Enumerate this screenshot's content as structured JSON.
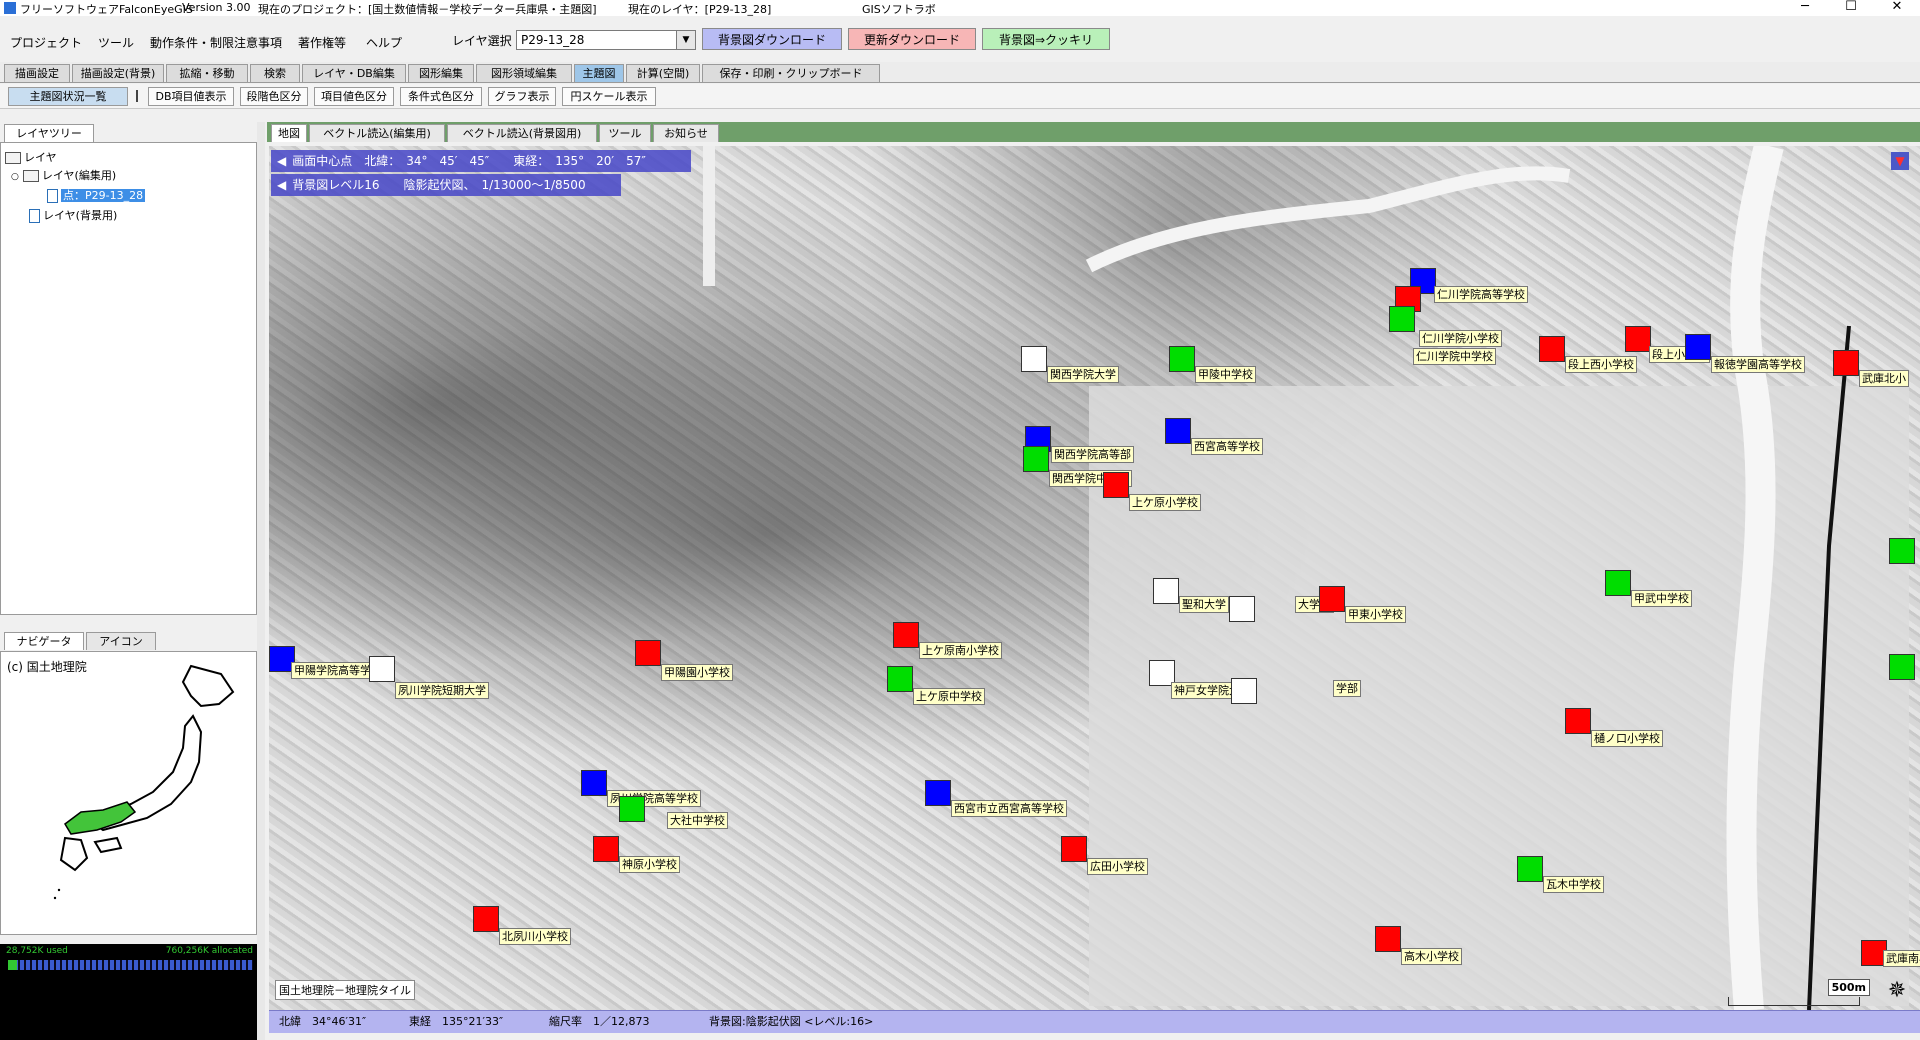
{
  "window": {
    "title": "フリーソフトウェアFalconEyeGIS",
    "version": "Version 3.00",
    "project": "現在のプロジェクト：[国土数値情報－学校データー兵庫県・主題図]",
    "current_layer": "現在のレイヤ：[P29-13_28]",
    "vendor": "GISソフトラボ",
    "min_glyph": "─",
    "max_glyph": "☐",
    "close_glyph": "✕"
  },
  "menu": {
    "items": [
      "プロジェクト",
      "ツール",
      "動作条件・制限注意事項",
      "著作権等",
      "ヘルプ"
    ]
  },
  "layer_select": {
    "label": "レイヤ選択",
    "value": "P29-13_28"
  },
  "top_buttons": {
    "bg_download": "背景図ダウンロード",
    "update_download": "更新ダウンロード",
    "bg_sharp": "背景図⇒クッキリ"
  },
  "tabs": [
    "描画設定",
    "描画設定(背景)",
    "拡縮・移動",
    "検索",
    "レイヤ・DB編集",
    "図形編集",
    "図形領域編集",
    "主題図",
    "計算(空間)",
    "保存・印刷・クリップボード"
  ],
  "active_tab": "主題図",
  "subtoolbar": [
    "主題図状況一覧",
    "DB項目値表示",
    "段階色区分",
    "項目値色区分",
    "条件式色区分",
    "グラフ表示",
    "円スケール表示"
  ],
  "left_tabs": {
    "layer_tree": "レイヤツリー",
    "navigator": "ナビゲータ",
    "icon": "アイコン"
  },
  "tree": {
    "root": "レイヤ",
    "edit": "レイヤ(編集用)",
    "point": "点：P29-13_28",
    "background": "レイヤ(背景用)"
  },
  "navigator": {
    "credit": "(c) 国土地理院"
  },
  "memory": {
    "used": "28,752K used",
    "allocated": "760,256K allocated"
  },
  "map_tabs": [
    "地図",
    "ベクトル読込(編集用)",
    "ベクトル読込(背景図用)",
    "ツール",
    "お知らせ"
  ],
  "map_info": {
    "center": "画面中心点　北緯：　34°　45′　45″　　東経：　135°　20′　57″",
    "background": "背景図レベル16　　陰影起伏図、　1/13000～1/8500",
    "north_badge": "▼"
  },
  "map_credit": "国土地理院－地理院タイル",
  "scale_text": "500m",
  "compass_glyph": "✵",
  "schools": [
    {
      "name": "仁川学院高等学校",
      "color": "#0000ff"
    },
    {
      "name": "仁川学院小学校",
      "color": "#ff0000"
    },
    {
      "name": "仁川学院中学校",
      "color": "#00dd00"
    },
    {
      "name": "段上西小学校",
      "color": "#ff0000"
    },
    {
      "name": "段上小学校",
      "color": "#ff0000"
    },
    {
      "name": "報徳学園高等学校",
      "color": "#0000ff"
    },
    {
      "name": "武庫北小",
      "color": "#ff0000"
    },
    {
      "name": "関西学院大学",
      "color": "#ffffff"
    },
    {
      "name": "甲陵中学校",
      "color": "#00dd00"
    },
    {
      "name": "西宮高等学校",
      "color": "#0000ff"
    },
    {
      "name": "関西学院高等部",
      "color": "#0000ff"
    },
    {
      "name": "関西学院中学部",
      "color": "#00dd00"
    },
    {
      "name": "上ケ原小学校",
      "color": "#ff0000"
    },
    {
      "name": "聖和大学",
      "color": "#ffffff"
    },
    {
      "name": "大学部",
      "color": "#ffffff"
    },
    {
      "name": "甲東小学校",
      "color": "#ff0000"
    },
    {
      "name": "甲武中学校",
      "color": "#00dd00"
    },
    {
      "name": "甲陽学院高等学校",
      "color": "#0000ff"
    },
    {
      "name": "夙川学院短期大学",
      "color": "#ffffff"
    },
    {
      "name": "甲陽園小学校",
      "color": "#ff0000"
    },
    {
      "name": "上ケ原南小学校",
      "color": "#ff0000"
    },
    {
      "name": "上ケ原中学校",
      "color": "#00dd00"
    },
    {
      "name": "神戸女学院大学",
      "color": "#ffffff"
    },
    {
      "name": "学部",
      "color": "#ffffff"
    },
    {
      "name": "樋ノ口小学校",
      "color": "#ff0000"
    },
    {
      "name": "夙川学院高等学校",
      "color": "#0000ff"
    },
    {
      "name": "大社中学校",
      "color": "#00dd00"
    },
    {
      "name": "西宮市立西宮高等学校",
      "color": "#0000ff"
    },
    {
      "name": "神原小学校",
      "color": "#ff0000"
    },
    {
      "name": "広田小学校",
      "color": "#ff0000"
    },
    {
      "name": "瓦木中学校",
      "color": "#00dd00"
    },
    {
      "name": "北夙川小学校",
      "color": "#ff0000"
    },
    {
      "name": "高木小学校",
      "color": "#ff0000"
    },
    {
      "name": "武庫南小",
      "color": "#ff0000"
    },
    {
      "name": "",
      "color": "#00dd00"
    },
    {
      "name": "",
      "color": "#00dd00"
    }
  ],
  "status": {
    "lat": "北緯　34°46′31″",
    "lon": "東経　135°21′33″",
    "scale": "縮尺率　1／12,873",
    "bg": "背景図:陰影起伏図 <レベル:16>"
  },
  "colors": {
    "map_tab_bar": "#6f9f6a",
    "overlay_blue": "#4646c8",
    "status_bar": "#b4b4f0",
    "label_bg": "#ffffc8"
  }
}
